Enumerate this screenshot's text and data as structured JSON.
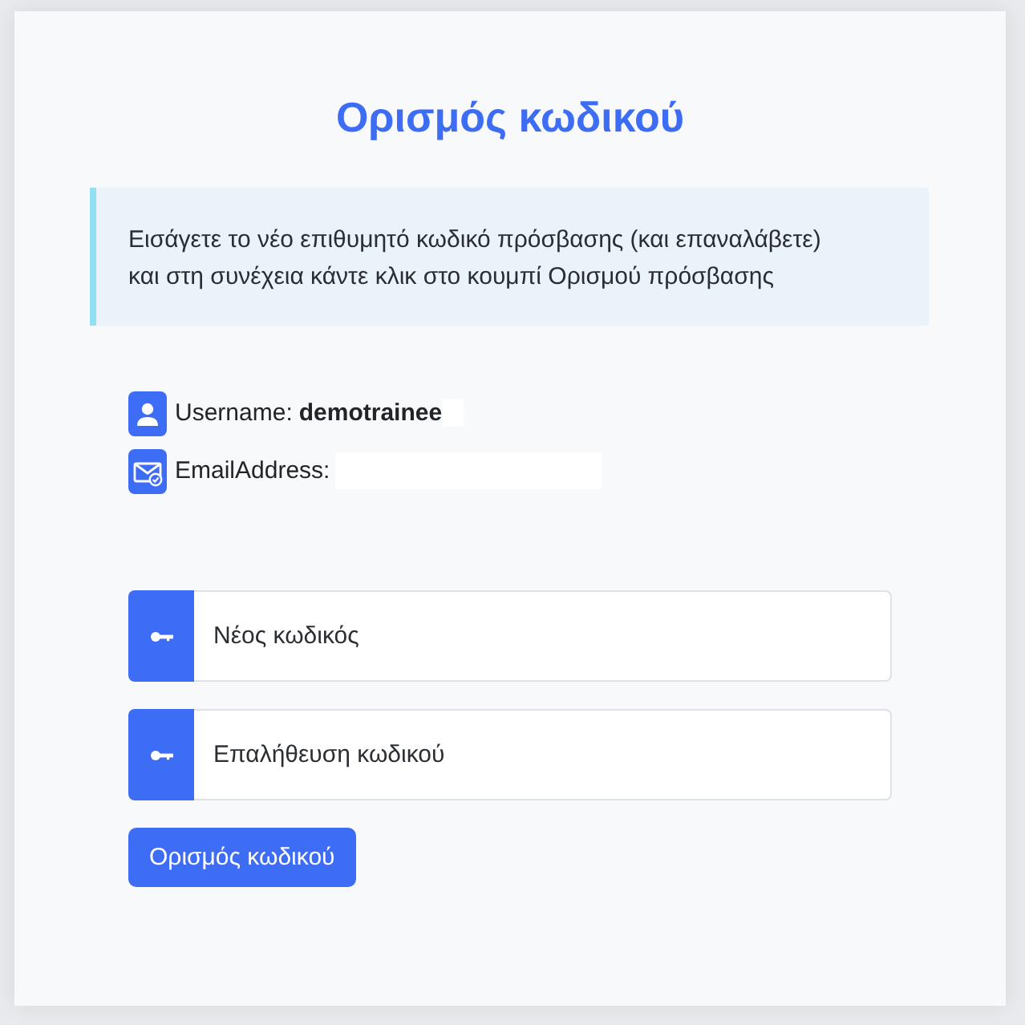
{
  "title": "Ορισμός κωδικού",
  "info": {
    "lines": [
      "Εισάγετε το νέο επιθυμητό κωδικό πρόσβασης (και επαναλάβετε)",
      "και στη συνέχεια κάντε κλικ στο κουμπί Ορισμού πρόσβασης"
    ]
  },
  "account": [
    {
      "kind": "username",
      "label": "Username:",
      "value": "demotrainee"
    },
    {
      "kind": "email",
      "label": "EmailAddress:"
    }
  ],
  "fields": [
    {
      "placeholder": "Νέος κωδικός"
    },
    {
      "placeholder": "Επαλήθευση κωδικού"
    }
  ],
  "button": {
    "label": "Ορισμός κωδικού"
  }
}
